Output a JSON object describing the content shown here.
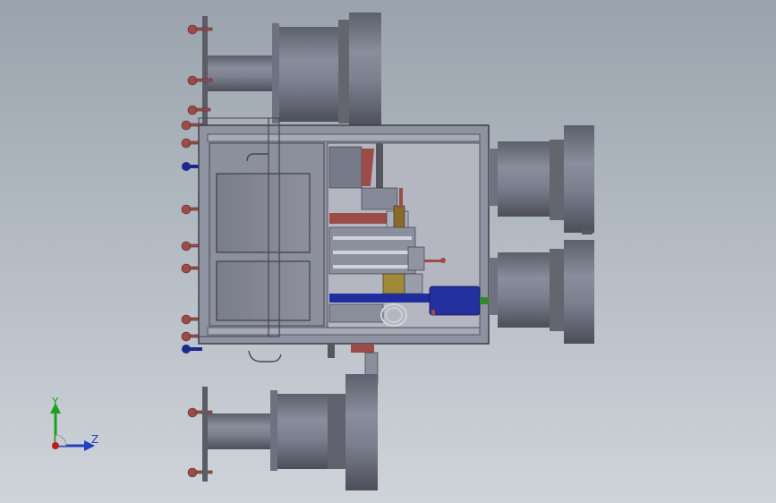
{
  "view": {
    "background_top": "#9aa3ad",
    "background_bottom": "#cfd4d9"
  },
  "triad": {
    "y_label": "Y",
    "z_label": "Z",
    "y_color": "#1aa31a",
    "z_color": "#1f3fbf",
    "origin_color": "#c41a1a"
  }
}
